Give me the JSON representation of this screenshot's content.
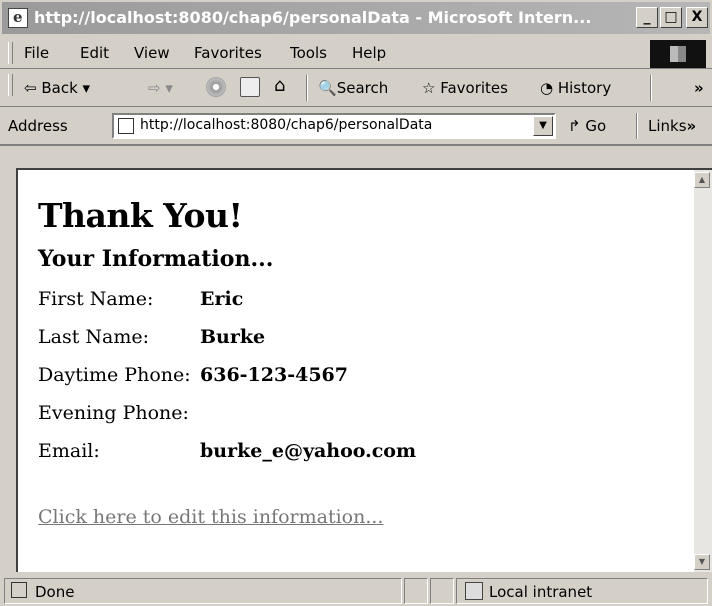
{
  "window": {
    "title": "http://localhost:8080/chap6/personalData - Microsoft Intern...",
    "minimize": "_",
    "maximize": "□",
    "close": "X"
  },
  "menu": [
    {
      "label": "File"
    },
    {
      "label": "Edit"
    },
    {
      "label": "View"
    },
    {
      "label": "Favorites"
    },
    {
      "label": "Tools"
    },
    {
      "label": "Help"
    }
  ],
  "toolbar": {
    "back": "Back",
    "search": "Search",
    "favorites": "Favorites",
    "history": "History",
    "more": "»"
  },
  "address": {
    "label": "Address",
    "value": "http://localhost:8080/chap6/personalData",
    "go": "Go",
    "links": "Links",
    "more": "»"
  },
  "page": {
    "heading": "Thank You!",
    "subheading": "Your Information...",
    "fields": [
      {
        "label": "First Name:",
        "value": "Eric"
      },
      {
        "label": "Last Name:",
        "value": "Burke"
      },
      {
        "label": "Daytime Phone:",
        "value": "636-123-4567"
      },
      {
        "label": "Evening Phone:",
        "value": ""
      },
      {
        "label": "Email:",
        "value": "burke_e@yahoo.com"
      }
    ],
    "edit_link": "Click here to edit this information..."
  },
  "status": {
    "text": "Done",
    "zone": "Local intranet"
  }
}
